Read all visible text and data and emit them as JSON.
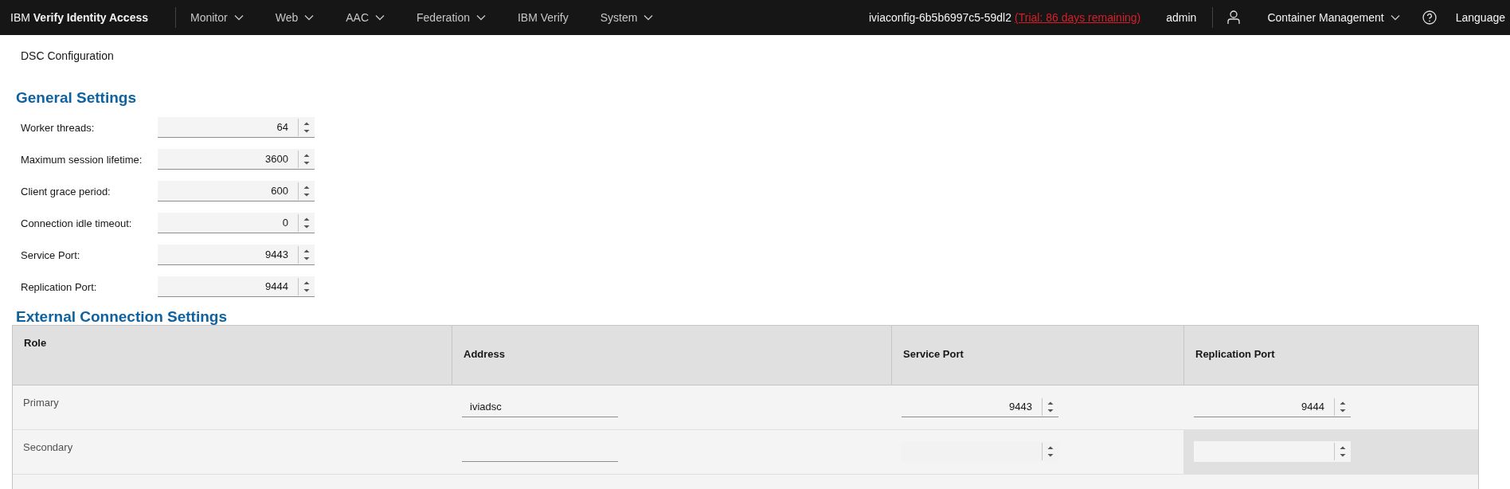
{
  "header": {
    "brand_prefix": "IBM",
    "brand": "Verify Identity Access",
    "nav": [
      {
        "label": "Monitor",
        "dropdown": true
      },
      {
        "label": "Web",
        "dropdown": true
      },
      {
        "label": "AAC",
        "dropdown": true
      },
      {
        "label": "Federation",
        "dropdown": true
      },
      {
        "label": "IBM Verify",
        "dropdown": false
      },
      {
        "label": "System",
        "dropdown": true
      }
    ],
    "host": "iviaconfig-6b5b6997c5-59dl2",
    "trial_link": "(Trial: 86 days remaining)",
    "user": "admin",
    "container_menu": "Container Management",
    "language": "Language"
  },
  "page_title": "DSC Configuration",
  "general": {
    "title": "General Settings",
    "fields": [
      {
        "label": "Worker threads:",
        "value": "64"
      },
      {
        "label": "Maximum session lifetime:",
        "value": "3600"
      },
      {
        "label": "Client grace period:",
        "value": "600"
      },
      {
        "label": "Connection idle timeout:",
        "value": "0"
      },
      {
        "label": "Service Port:",
        "value": "9443"
      },
      {
        "label": "Replication Port:",
        "value": "9444"
      }
    ]
  },
  "external": {
    "title": "External Connection Settings",
    "columns": [
      "Role",
      "Address",
      "Service Port",
      "Replication Port"
    ],
    "rows": [
      {
        "role": "Primary",
        "address": {
          "value": "iviadsc",
          "disabled": false
        },
        "service_port": {
          "value": "9443",
          "disabled": false
        },
        "replication_port": {
          "value": "9444",
          "disabled": false,
          "highlighted": false
        }
      },
      {
        "role": "Secondary",
        "address": {
          "disabled": false
        },
        "service_port": {
          "disabled": true
        },
        "replication_port": {
          "disabled": true,
          "highlighted": true
        }
      }
    ]
  }
}
